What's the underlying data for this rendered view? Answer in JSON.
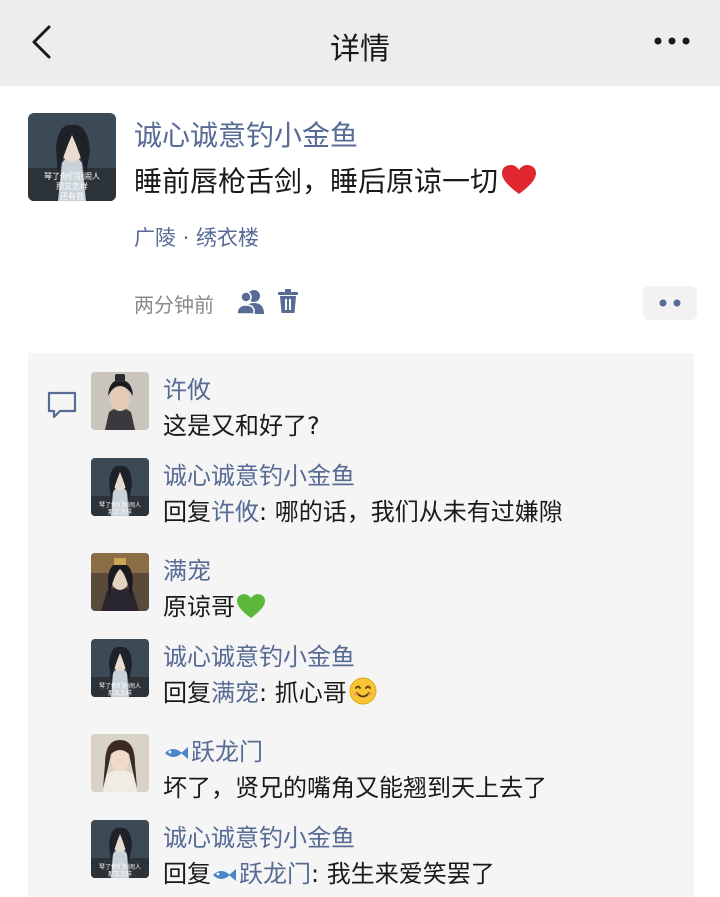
{
  "nav": {
    "title": "详情",
    "back_icon": "chevron-left-icon",
    "more_icon": "ellipsis-icon"
  },
  "post": {
    "author": "诚心诚意钓小金鱼",
    "text": "睡前唇枪舌剑，睡后原谅一切",
    "text_emoji": "red-heart-emoji",
    "location": "广陵 · 绣衣楼",
    "time": "两分钟前",
    "avatar_caption": "琴了你们别闹人 那又怎样 还有我"
  },
  "colors": {
    "link": "#576b95",
    "nav_bg": "#ededed",
    "comment_bg": "#f5f5f5"
  },
  "comments": [
    {
      "author": "许攸",
      "text": "这是又和好了?"
    },
    {
      "author": "诚心诚意钓小金鱼",
      "reply_prefix": "回复",
      "reply_to": "许攸",
      "text": ": 哪的话，我们从未有过嫌隙"
    },
    {
      "author": "满宠",
      "text": "原谅哥",
      "emoji": "green-heart-emoji"
    },
    {
      "author": "诚心诚意钓小金鱼",
      "reply_prefix": "回复",
      "reply_to": "满宠",
      "text": ": 抓心哥",
      "emoji": "smile-emoji"
    },
    {
      "author": "跃龙门",
      "author_icon": "fish-emoji",
      "text": "坏了，贤兄的嘴角又能翘到天上去了"
    },
    {
      "author": "诚心诚意钓小金鱼",
      "reply_prefix": "回复",
      "reply_to": "跃龙门",
      "reply_to_icon": "fish-emoji",
      "text": ": 我生来爱笑罢了"
    }
  ]
}
